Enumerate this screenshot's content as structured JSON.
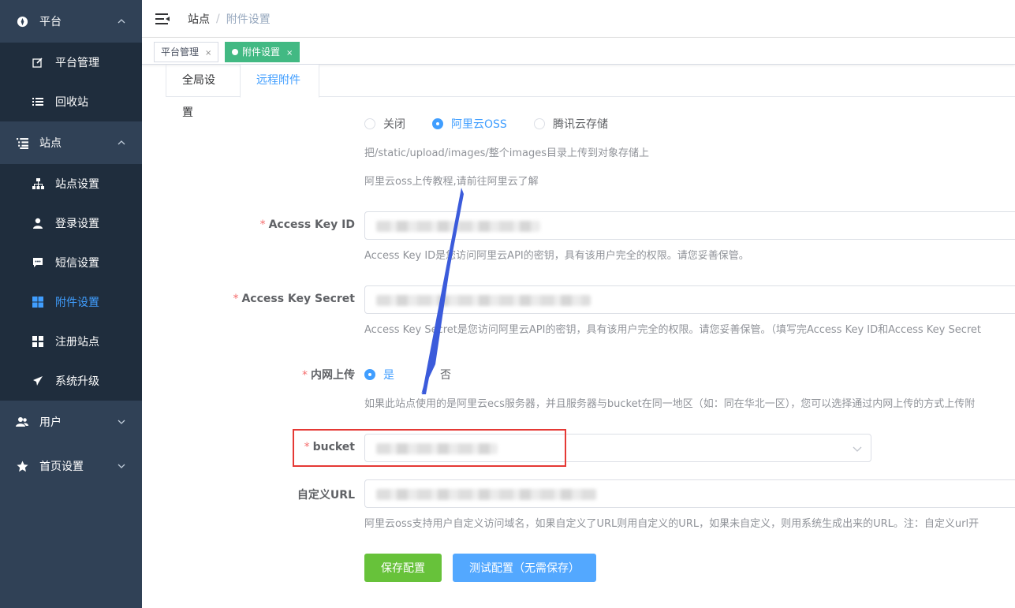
{
  "sidebar": {
    "groups": [
      {
        "label": "平台",
        "icon": "compass-icon",
        "expanded": true,
        "items": [
          {
            "label": "平台管理",
            "icon": "edit-icon"
          },
          {
            "label": "回收站",
            "icon": "list-icon"
          }
        ]
      },
      {
        "label": "站点",
        "icon": "list-tree-icon",
        "expanded": true,
        "items": [
          {
            "label": "站点设置",
            "icon": "sitemap-icon"
          },
          {
            "label": "登录设置",
            "icon": "user-icon"
          },
          {
            "label": "短信设置",
            "icon": "chat-icon"
          },
          {
            "label": "附件设置",
            "icon": "grid-icon",
            "active": true
          },
          {
            "label": "注册站点",
            "icon": "grid-icon"
          },
          {
            "label": "系统升级",
            "icon": "send-icon"
          }
        ]
      },
      {
        "label": "用户",
        "icon": "users-icon",
        "expanded": false
      },
      {
        "label": "首页设置",
        "icon": "star-icon",
        "expanded": false
      }
    ]
  },
  "header": {
    "breadcrumb_home": "站点",
    "breadcrumb_sep": "/",
    "breadcrumb_current": "附件设置"
  },
  "tags": [
    {
      "label": "平台管理",
      "close": "×",
      "active": false
    },
    {
      "label": "附件设置",
      "close": "×",
      "active": true
    }
  ],
  "tabs": [
    {
      "label": "全局设置",
      "active": false
    },
    {
      "label": "远程附件",
      "active": true
    }
  ],
  "form": {
    "storage_options": [
      {
        "label": "关闭",
        "checked": false
      },
      {
        "label": "阿里云OSS",
        "checked": true
      },
      {
        "label": "腾讯云存储",
        "checked": false
      }
    ],
    "storage_hint": "把/static/upload/images/整个images目录上传到对象存储上",
    "tutorial_hint": "阿里云oss上传教程,请前往阿里云了解",
    "access_key_id": {
      "required": "*",
      "label": "Access Key ID",
      "hint": "Access Key ID是您访问阿里云API的密钥，具有该用户完全的权限。请您妥善保管。"
    },
    "access_key_secret": {
      "required": "*",
      "label": "Access Key Secret",
      "hint": "Access Key Secret是您访问阿里云API的密钥，具有该用户完全的权限。请您妥善保管。（填写完Access Key ID和Access Key Secret"
    },
    "intranet": {
      "required": "*",
      "label": "内网上传",
      "options": [
        {
          "label": "是",
          "checked": true
        },
        {
          "label": "否",
          "checked": false
        }
      ],
      "hint": "如果此站点使用的是阿里云ecs服务器，并且服务器与bucket在同一地区（如：同在华北一区），您可以选择通过内网上传的方式上传附"
    },
    "bucket": {
      "required": "*",
      "label": "bucket"
    },
    "custom_url": {
      "label": "自定义URL",
      "hint": "阿里云oss支持用户自定义访问域名，如果自定义了URL则用自定义的URL，如果未自定义，则用系统生成出来的URL。注：自定义url开"
    },
    "save_button": "保存配置",
    "test_button": "测试配置（无需保存）"
  },
  "colors": {
    "sidebar_bg": "#304156",
    "submenu_bg": "#1f2d3d",
    "accent": "#409eff",
    "tag_active": "#42b983",
    "save_button": "#67c23a",
    "test_button": "#53a8ff",
    "highlight_box": "#e53935",
    "annotation_arrow": "#3b5bdb"
  }
}
